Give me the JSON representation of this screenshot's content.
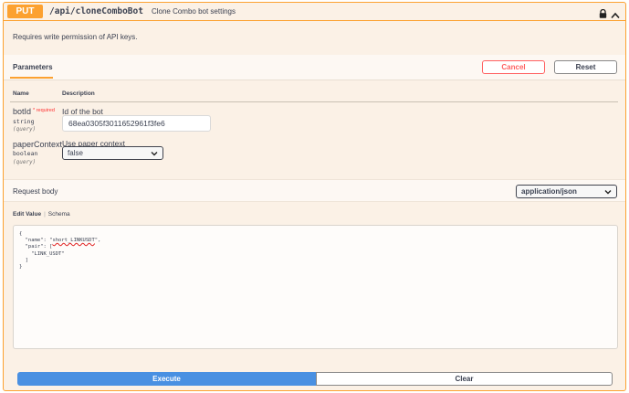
{
  "operation": {
    "method": "PUT",
    "path": "/api/cloneComboBot",
    "summary": "Clone Combo bot settings",
    "description": "Requires write permission of API keys."
  },
  "params_section": {
    "tab_label": "Parameters",
    "cancel_label": "Cancel",
    "reset_label": "Reset",
    "col_name": "Name",
    "col_description": "Description",
    "rows": [
      {
        "name": "botId",
        "required": "* required",
        "type": "string",
        "in": "(query)",
        "description": "Id of the bot",
        "value": "68ea0305f3011652961f3fe6"
      },
      {
        "name": "paperContext",
        "type": "boolean",
        "in": "(query)",
        "description": "Use paper context",
        "selected": "false"
      }
    ]
  },
  "request_body": {
    "title": "Request body",
    "content_type": "application/json",
    "tab_edit": "Edit Value",
    "tab_schema": "Schema",
    "lines": [
      "{",
      "  \"name\": \"",
      "short_LINKUSDT",
      "\",",
      "  \"pair\": [",
      "    \"LINK_USDT\"",
      "  ]",
      "}"
    ]
  },
  "actions": {
    "execute_label": "Execute",
    "clear_label": "Clear"
  },
  "colors": {
    "put_accent": "#fca130",
    "execute_blue": "#4990e2",
    "cancel_red": "#ff6060"
  }
}
